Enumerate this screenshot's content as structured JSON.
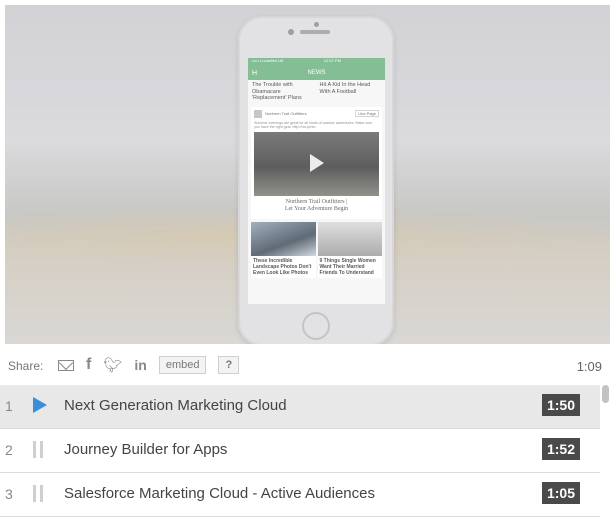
{
  "video": {
    "phone": {
      "status_left": "••••• Lucasfilm UK",
      "status_time": "12:57 PM",
      "nav_title": "NEWS",
      "nav_icon": "H",
      "headline_left": "The Trouble with Obamacare 'Replacement' Plans",
      "headline_right": "Hit A Kid In the Head With A Football",
      "card_source": "Northern Trail Outfitters",
      "card_like": "Like Page",
      "card_text": "Summer evenings are great for all kinds of outdoor adventures. Make sure you have the right gear. http://ow.ly/nto",
      "video_caption_line1": "Northern Trail Outfitters |",
      "video_caption_line2": "Let Your Adventure Begin",
      "thumb1_text": "These Incredible Landscape Photos Don't Even Look Like Photos",
      "thumb2_text": "9 Things Single Women Want Their Married Friends To Understand"
    }
  },
  "share": {
    "label": "Share:",
    "embed_label": "embed",
    "help_label": "?",
    "duration": "1:09"
  },
  "playlist": [
    {
      "index": "1",
      "title": "Next Generation Marketing Cloud",
      "time": "1:50",
      "state": "playing"
    },
    {
      "index": "2",
      "title": "Journey Builder for Apps",
      "time": "1:52",
      "state": "paused"
    },
    {
      "index": "3",
      "title": "Salesforce Marketing Cloud - Active Audiences",
      "time": "1:05",
      "state": "paused"
    }
  ],
  "icons": {
    "share_mail": "mail-icon",
    "share_facebook": "facebook-icon",
    "share_twitter": "twitter-icon",
    "share_linkedin": "linkedin-icon",
    "play": "play-icon",
    "pause": "pause-icon"
  },
  "colors": {
    "accent_play": "#3a8fd9",
    "phone_header": "#6ab07e",
    "time_badge": "#4a4a4a"
  }
}
